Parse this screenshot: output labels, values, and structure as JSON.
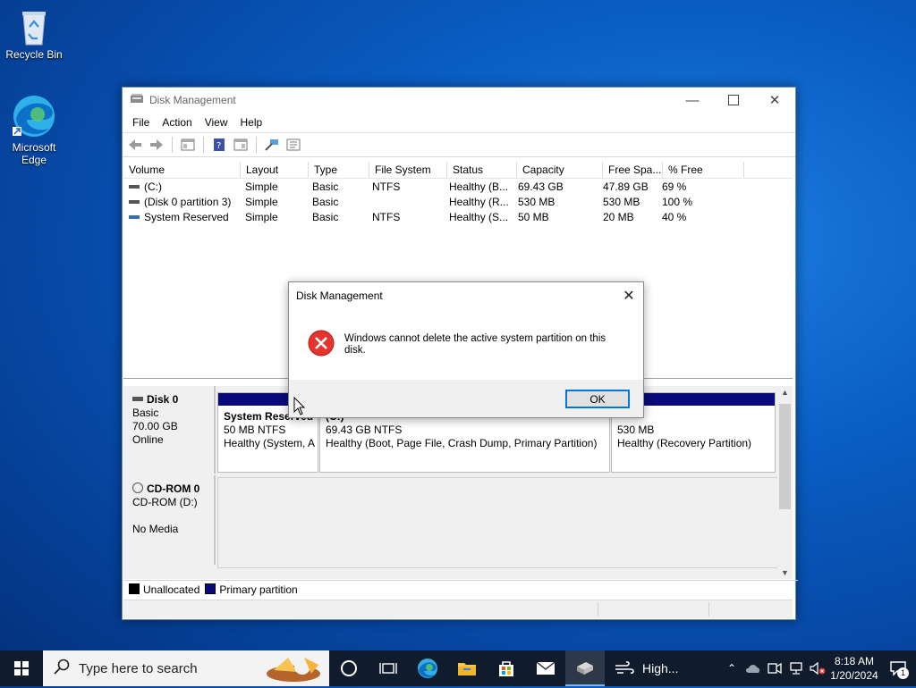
{
  "desktop": {
    "icons": [
      {
        "label": "Recycle Bin"
      },
      {
        "label": "Microsoft Edge",
        "line1": "Microsoft",
        "line2": "Edge"
      }
    ]
  },
  "window": {
    "title": "Disk Management",
    "menu": [
      "File",
      "Action",
      "View",
      "Help"
    ],
    "toolbar_icons": [
      "back-icon",
      "forward-icon",
      "console-tree-icon",
      "help-icon",
      "properties-icon",
      "connect-icon",
      "settings-icon"
    ],
    "columns": [
      "Volume",
      "Layout",
      "Type",
      "File System",
      "Status",
      "Capacity",
      "Free Spa...",
      "% Free"
    ],
    "rows": [
      {
        "volume": "(C:)",
        "layout": "Simple",
        "type": "Basic",
        "fs": "NTFS",
        "status": "Healthy (B...",
        "capacity": "69.43 GB",
        "free": "47.89 GB",
        "pct": "69 %"
      },
      {
        "volume": "(Disk 0 partition 3)",
        "layout": "Simple",
        "type": "Basic",
        "fs": "",
        "status": "Healthy (R...",
        "capacity": "530 MB",
        "free": "530 MB",
        "pct": "100 %"
      },
      {
        "volume": "System Reserved",
        "layout": "Simple",
        "type": "Basic",
        "fs": "NTFS",
        "status": "Healthy (S...",
        "capacity": "50 MB",
        "free": "20 MB",
        "pct": "40 %"
      }
    ],
    "disk0": {
      "name": "Disk 0",
      "kind": "Basic",
      "size": "70.00 GB",
      "state": "Online",
      "partitions": [
        {
          "title": "System Reserved",
          "line1": "50 MB NTFS",
          "line2": "Healthy (System, A"
        },
        {
          "title": "(C:)",
          "line1": "69.43 GB NTFS",
          "line2": "Healthy (Boot, Page File, Crash Dump, Primary Partition)"
        },
        {
          "title": "",
          "line1": "530 MB",
          "line2": "Healthy (Recovery Partition)"
        }
      ]
    },
    "cdrom": {
      "name": "CD-ROM 0",
      "kind": "CD-ROM (D:)",
      "media": "No Media"
    },
    "legend": {
      "unallocated": "Unallocated",
      "primary": "Primary partition",
      "unallocated_color": "#000000",
      "primary_color": "#0a0a7c"
    }
  },
  "dialog": {
    "title": "Disk Management",
    "message": "Windows cannot delete the active system partition on this disk.",
    "ok": "OK"
  },
  "taskbar": {
    "search_placeholder": "Type here to search",
    "weather": "High...",
    "time": "8:18 AM",
    "date": "1/20/2024",
    "notification_count": "1"
  }
}
